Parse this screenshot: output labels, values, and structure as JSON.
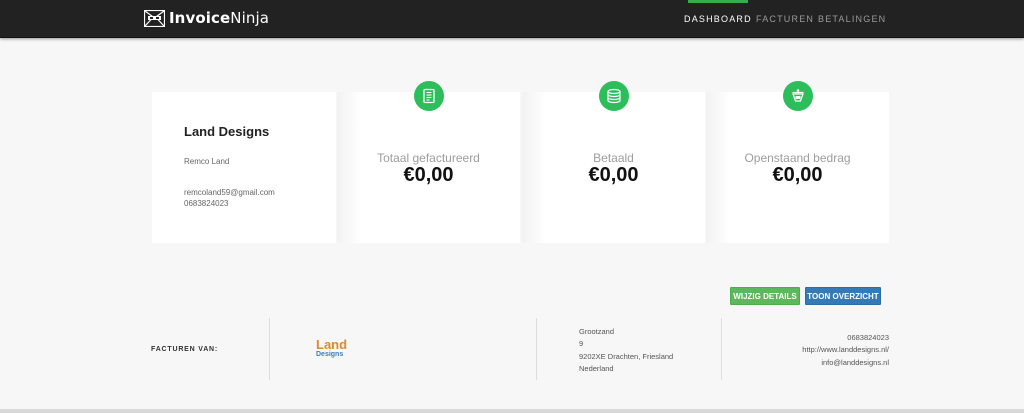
{
  "app": {
    "brand_bold": "Invoice",
    "brand_light": "Ninja"
  },
  "nav": {
    "items": [
      {
        "label": "DASHBOARD",
        "active": true
      },
      {
        "label": "FACTUREN",
        "active": false
      },
      {
        "label": "BETALINGEN",
        "active": false
      }
    ]
  },
  "client": {
    "name": "Land Designs",
    "contact": "Remco Land",
    "email": "remcoland59@gmail.com",
    "phone": "0683824023"
  },
  "stats": [
    {
      "label": "Totaal gefactureerd",
      "value": "€0,00",
      "icon": "invoice-icon"
    },
    {
      "label": "Betaald",
      "value": "€0,00",
      "icon": "coins-icon"
    },
    {
      "label": "Openstaand bedrag",
      "value": "€0,00",
      "icon": "scale-icon"
    }
  ],
  "buttons": {
    "edit": "WIJZIG DETAILS",
    "view": "TOON OVERZICHT"
  },
  "footer": {
    "invoices_from": "FACTUREN VAN:",
    "logo_line1": "Land",
    "logo_line2": "Designs",
    "address": [
      "Grootzand",
      "9",
      "9202XE Drachten, Friesland",
      "Nederland"
    ],
    "contact": [
      "0683824023",
      "http://www.landdesigns.nl/",
      "info@landdesigns.nl"
    ]
  },
  "colors": {
    "navbar": "#222222",
    "accent": "#2dbd5a",
    "edit_button": "#5cb85c",
    "view_button": "#337ab7"
  }
}
